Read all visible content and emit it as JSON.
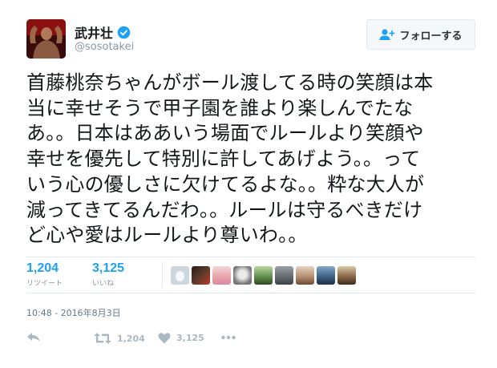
{
  "user": {
    "display_name": "武井壮",
    "handle": "@sosotakei"
  },
  "follow_button": {
    "label": "フォローする"
  },
  "tweet": {
    "lines": [
      "首藤桃奈ちゃんがボール渡してる時の笑顔は本",
      "当に幸せそうで甲子園を誰より楽しんでたな",
      "あ。。日本はああいう場面でルールより笑顔や",
      "幸せを優先して特別に許してあげよう。。って",
      "いう心の優しさに欠けてるよな。。粋な大人が",
      "減ってきてるんだわ。。ルールは守るべきだけ",
      "ど心や愛はルールより尊いわ。。"
    ]
  },
  "stats": {
    "retweets": {
      "value": "1,204",
      "label": "リツイート"
    },
    "likes": {
      "value": "3,125",
      "label": "いいね"
    }
  },
  "timestamp": "10:48 - 2016年8月3日",
  "actions": {
    "retweet_count": "1,204",
    "like_count": "3,125"
  },
  "colors": {
    "accent": "#1da1f2",
    "muted": "#8899a6",
    "action_icon": "#aab8c2"
  },
  "icons": [
    "reply-icon",
    "retweet-icon",
    "heart-icon",
    "more-icon",
    "verified-icon",
    "follow-person-icon"
  ]
}
